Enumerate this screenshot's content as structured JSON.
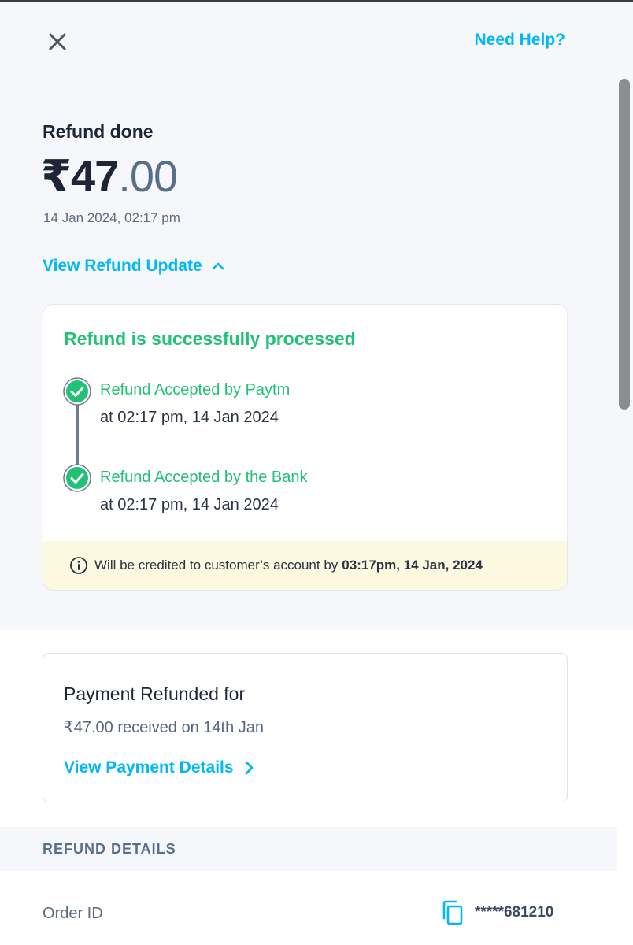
{
  "header": {
    "close_icon": "close-icon",
    "help_label": "Need Help?"
  },
  "refund": {
    "status_title": "Refund done",
    "amount_whole": "₹47",
    "amount_decimal": ".00",
    "datetime": "14 Jan 2024, 02:17 pm",
    "view_update_label": "View Refund Update"
  },
  "progress": {
    "title": "Refund is successfully processed",
    "steps": [
      {
        "title": "Refund Accepted by Paytm",
        "time": "at 02:17 pm, 14 Jan 2024"
      },
      {
        "title": "Refund Accepted by the Bank",
        "time": "at 02:17 pm, 14 Jan 2024"
      }
    ],
    "info_text": "Will be credited to customer’s account by",
    "info_bold": "03:17pm, 14 Jan, 2024"
  },
  "payment": {
    "title": "Payment Refunded for",
    "subtitle": "₹47.00 received on 14th Jan",
    "link_label": "View Payment Details"
  },
  "details": {
    "section_title": "REFUND DETAILS",
    "order_id_label": "Order ID",
    "order_id_value": "*****681210"
  },
  "colors": {
    "accent": "#00b8f5",
    "success": "#21c177",
    "info_bg": "#fdf8e0",
    "hero_bg": "#f5f7fb"
  }
}
